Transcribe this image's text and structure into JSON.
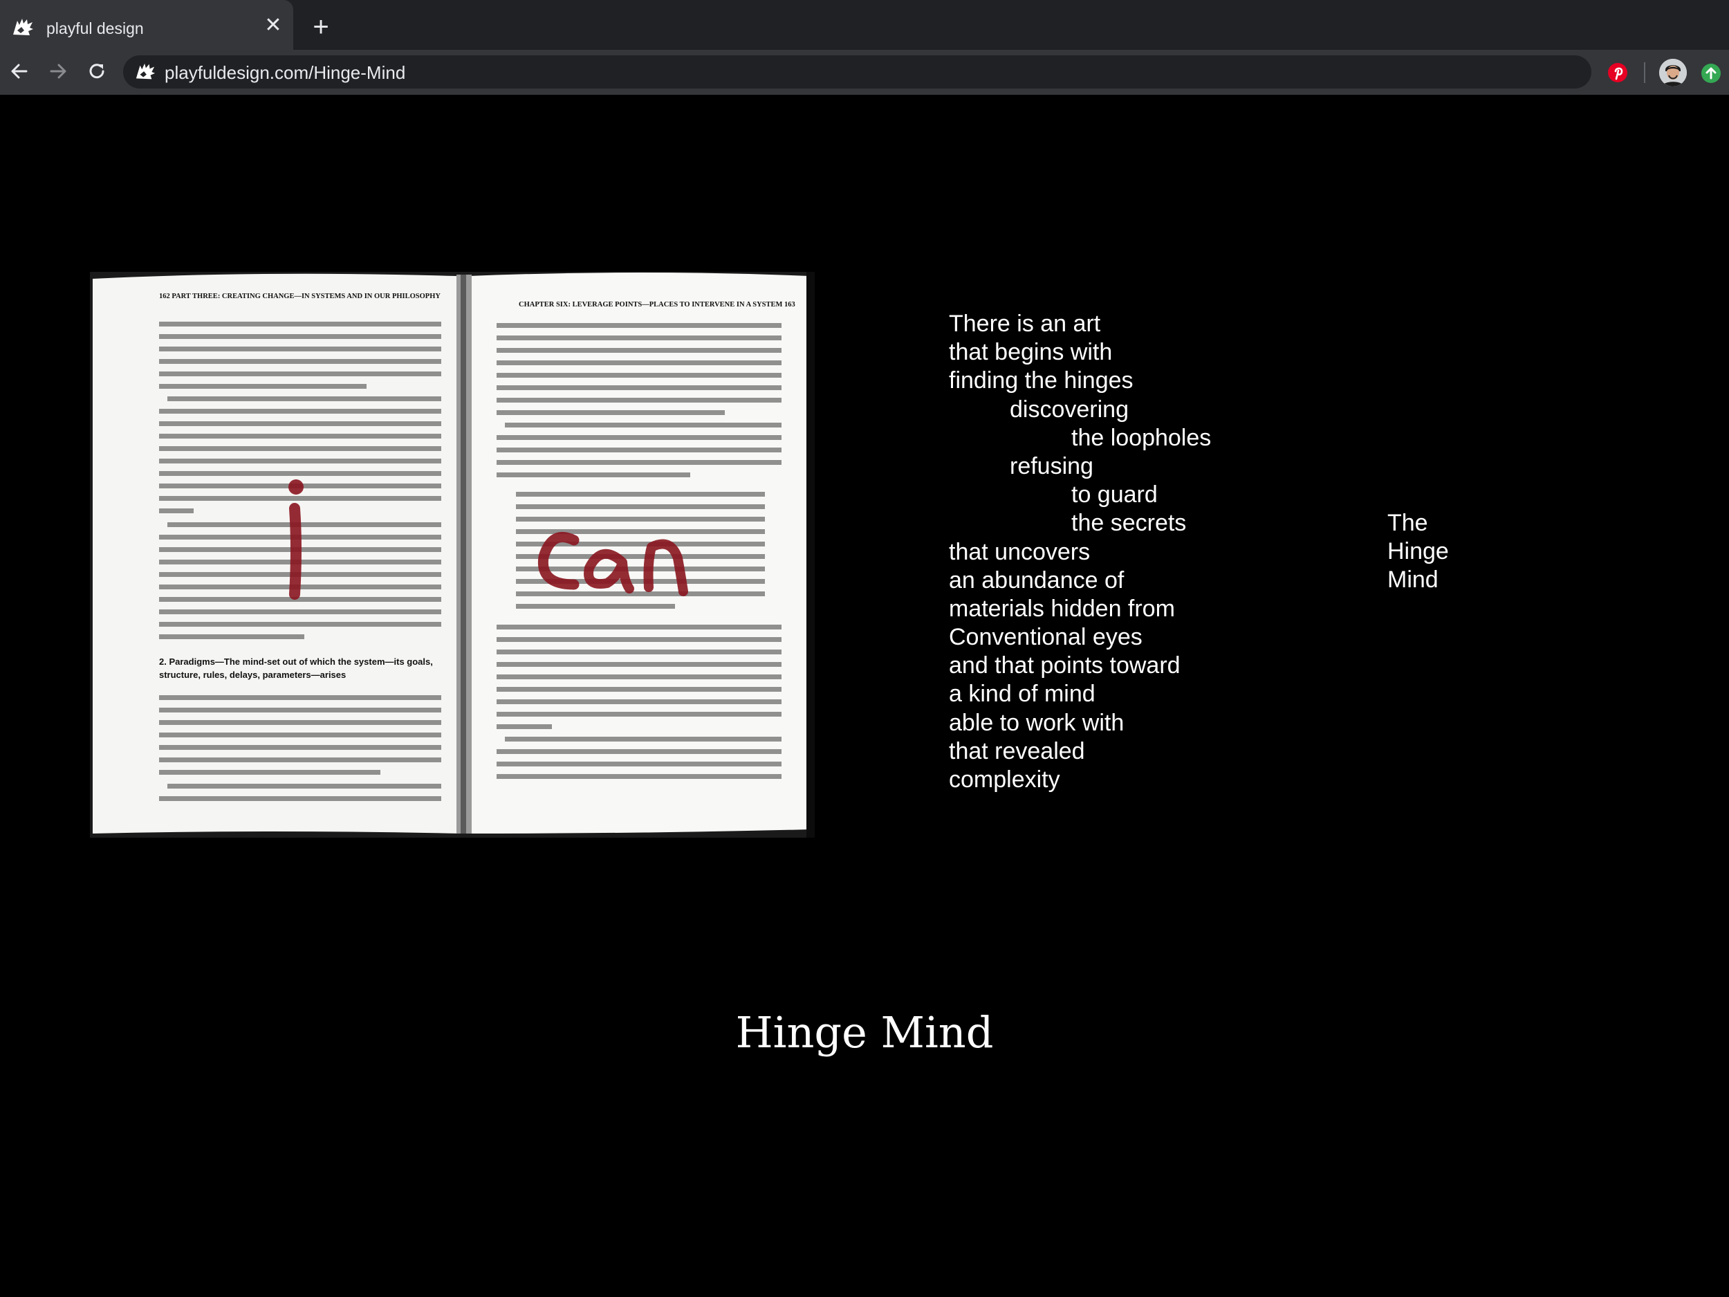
{
  "browser": {
    "tab": {
      "title": "playful design",
      "close_glyph": "✕"
    },
    "new_tab_glyph": "+",
    "address_bar": {
      "url": "playfuldesign.com/Hinge-Mind"
    },
    "icons": {
      "favicon": "playful-design-logo-icon",
      "back": "arrow-left-icon",
      "forward": "arrow-right-icon",
      "reload": "reload-icon",
      "pinterest": "pinterest-icon",
      "profile": "profile-avatar",
      "update": "update-arrow-icon"
    },
    "colors": {
      "tab_bar": "#202124",
      "toolbar": "#35363a",
      "omnibox": "#202124",
      "text": "#e8eaed",
      "pinterest_red": "#e60023",
      "update_green": "#34a853"
    }
  },
  "page": {
    "background": "#000000",
    "image": {
      "description": "open book photograph with handwritten red 'i can' overlay",
      "handwriting": "i can",
      "left_page": {
        "header": "162   PART THREE: CREATING CHANGE—IN SYSTEMS AND IN OUR PHILOSOPHY",
        "section_heading_1": "2. Paradigms—The mind-set out of which the system—its goals,",
        "section_heading_2": "structure, rules, delays, parameters—arises"
      },
      "right_page": {
        "header": "CHAPTER SIX: LEVERAGE POINTS—PLACES TO INTERVENE IN A SYSTEM   163"
      }
    },
    "poem": {
      "lines": [
        {
          "text": "There is an art",
          "indent": 0
        },
        {
          "text": "that begins with",
          "indent": 0
        },
        {
          "text": "finding the hinges",
          "indent": 0
        },
        {
          "text": "discovering",
          "indent": 1
        },
        {
          "text": "the loopholes",
          "indent": 2
        },
        {
          "text": "refusing",
          "indent": 1
        },
        {
          "text": "to guard",
          "indent": 2
        },
        {
          "text": "the secrets",
          "indent": 2
        },
        {
          "text": "that uncovers",
          "indent": 0
        },
        {
          "text": "an abundance of",
          "indent": 0
        },
        {
          "text": "materials hidden from",
          "indent": 0
        },
        {
          "text": "Conventional eyes",
          "indent": 0
        },
        {
          "text": "and that points toward",
          "indent": 0
        },
        {
          "text": "a kind of mind",
          "indent": 0
        },
        {
          "text": "able to work with",
          "indent": 0
        },
        {
          "text": "that revealed",
          "indent": 0
        },
        {
          "text": "complexity",
          "indent": 0
        }
      ]
    },
    "side_title": {
      "lines": [
        "The",
        "Hinge",
        "Mind"
      ]
    },
    "title": "Hinge Mind"
  }
}
